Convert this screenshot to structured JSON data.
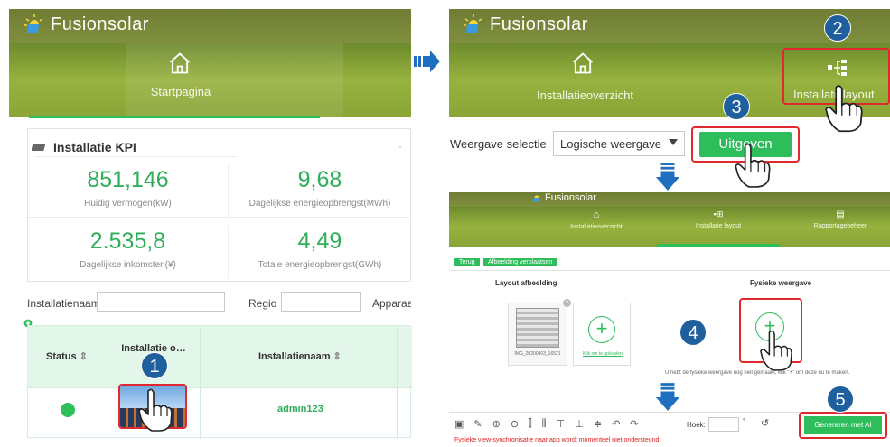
{
  "left_panel": {
    "brand": "Fusionsolar",
    "home_label": "Startpagina",
    "kpi": {
      "title": "Installatie KPI",
      "items": [
        {
          "value": "851,146",
          "label": "Huidig vermogen(kW)"
        },
        {
          "value": "9,68",
          "label": "Dagelijkse energieopbrengst(MWh)"
        },
        {
          "value": "2.535,8",
          "label": "Dagelijkse inkomsten(¥)"
        },
        {
          "value": "4,49",
          "label": "Totale energieopbrengst(GWh)"
        }
      ]
    },
    "filters": {
      "installation_name_label": "Installatienaam",
      "region_label": "Regio",
      "device_label": "Apparaat"
    },
    "table": {
      "headers": [
        "Status",
        "Installatie o…zicht",
        "Installatienaam"
      ],
      "rows": [
        {
          "status_color": "#2fbf5a",
          "installation_name": "admin123"
        }
      ]
    },
    "step_badge": "1"
  },
  "right_top": {
    "brand": "Fusionsolar",
    "nav": [
      {
        "label": "Installatieoverzicht"
      },
      {
        "label": "Installatielayout"
      }
    ],
    "step_badges": [
      "2",
      "3"
    ],
    "view_select_label": "Weergave selectie",
    "view_select_value": "Logische weergave",
    "edit_button": "Uitgeven"
  },
  "right_bottom": {
    "brand": "Fusionsolar",
    "nav": [
      {
        "label": "Installatieoverzicht"
      },
      {
        "label": "Installatie layout"
      },
      {
        "label": "Rapportagebeheer"
      }
    ],
    "back_button": "Terug",
    "move_image_button": "Afbeelding verplaatsen",
    "layout_image_title": "Layout afbeelding",
    "physical_view_title": "Fysieke weergave",
    "thumb_caption": "IMG_20200403_16521",
    "upload_label": "Klik om te uploaden",
    "hint_text": "U hebt de fysieke weergave nog niet gemaakt, klik \"+\" om deze nu te maken.",
    "angle_label": "Hoek:",
    "angle_unit": "°",
    "generate_button": "Genereren met AI",
    "warning_text": "Fysieke view-synchronisatie naar app wordt momenteel niet ondersteund",
    "step_badges": [
      "4",
      "5"
    ]
  },
  "colors": {
    "accent_green": "#2fae5a",
    "highlight_red": "#e0282f",
    "badge_blue": "#1f5f9e",
    "warning_red": "#e02020"
  }
}
